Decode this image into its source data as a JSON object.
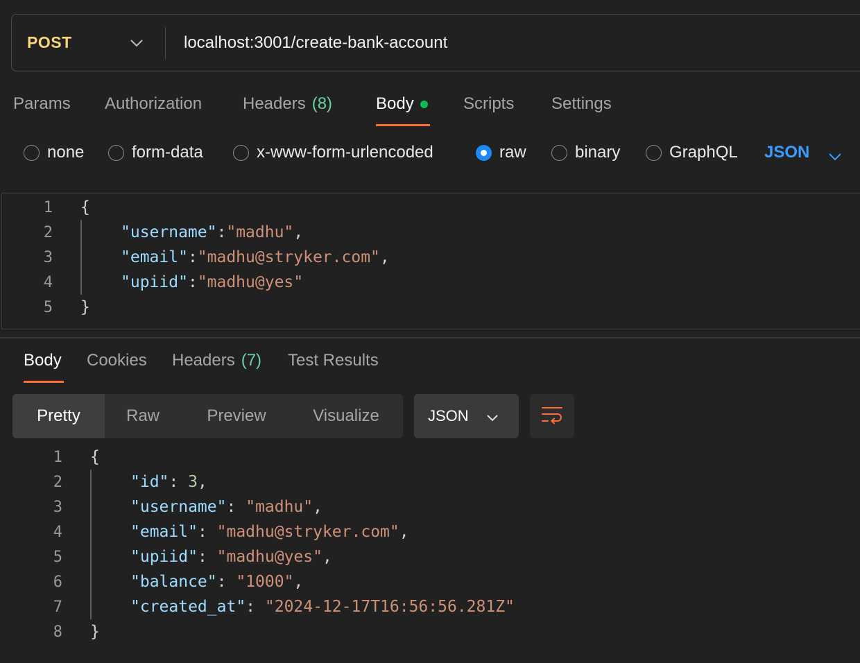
{
  "colors": {
    "method": "#F8D47A",
    "accent": "#FF6C37",
    "count": "#6BD0A0",
    "dot": "#0CBB52",
    "radio_checked": "#1E88F5",
    "lang_select": "#3B9CFF",
    "json_key": "#9CDCFE",
    "json_string": "#CE9178",
    "json_number": "#B5CEA8",
    "punct": "#D4D4D4"
  },
  "request": {
    "method": "POST",
    "url": "localhost:3001/create-bank-account",
    "method_chevron_icon": "chevron-down-icon"
  },
  "request_tabs": [
    {
      "label": "Params"
    },
    {
      "label": "Authorization"
    },
    {
      "label": "Headers",
      "count": "(8)"
    },
    {
      "label": "Body",
      "active": true,
      "dot": true
    },
    {
      "label": "Scripts"
    },
    {
      "label": "Settings"
    }
  ],
  "body_types": [
    {
      "label": "none"
    },
    {
      "label": "form-data"
    },
    {
      "label": "x-www-form-urlencoded"
    },
    {
      "label": "raw",
      "selected": true
    },
    {
      "label": "binary"
    },
    {
      "label": "GraphQL"
    }
  ],
  "body_language": "JSON",
  "request_body": {
    "line_numbers": [
      "1",
      "2",
      "3",
      "4",
      "5"
    ],
    "open_brace": "{",
    "close_brace": "}",
    "fields": [
      {
        "key": "\"username\"",
        "value": "\"madhu\""
      },
      {
        "key": "\"email\"",
        "value": "\"madhu@stryker.com\""
      },
      {
        "key": "\"upiid\"",
        "value": "\"madhu@yes\""
      }
    ]
  },
  "response_tabs": [
    {
      "label": "Body",
      "active": true
    },
    {
      "label": "Cookies"
    },
    {
      "label": "Headers",
      "count": "(7)"
    },
    {
      "label": "Test Results"
    }
  ],
  "view_modes": [
    {
      "label": "Pretty",
      "active": true
    },
    {
      "label": "Raw"
    },
    {
      "label": "Preview"
    },
    {
      "label": "Visualize"
    }
  ],
  "response_format": "JSON",
  "wrap_icon": "wrap-lines-icon",
  "response_body": {
    "line_numbers": [
      "1",
      "2",
      "3",
      "4",
      "5",
      "6",
      "7",
      "8"
    ],
    "open_brace": "{",
    "close_brace": "}",
    "fields": [
      {
        "key": "\"id\"",
        "value": "3",
        "type": "number"
      },
      {
        "key": "\"username\"",
        "value": "\"madhu\"",
        "type": "string"
      },
      {
        "key": "\"email\"",
        "value": "\"madhu@stryker.com\"",
        "type": "string"
      },
      {
        "key": "\"upiid\"",
        "value": "\"madhu@yes\"",
        "type": "string"
      },
      {
        "key": "\"balance\"",
        "value": "\"1000\"",
        "type": "string"
      },
      {
        "key": "\"created_at\"",
        "value": "\"2024-12-17T16:56:56.281Z\"",
        "type": "string"
      }
    ]
  }
}
